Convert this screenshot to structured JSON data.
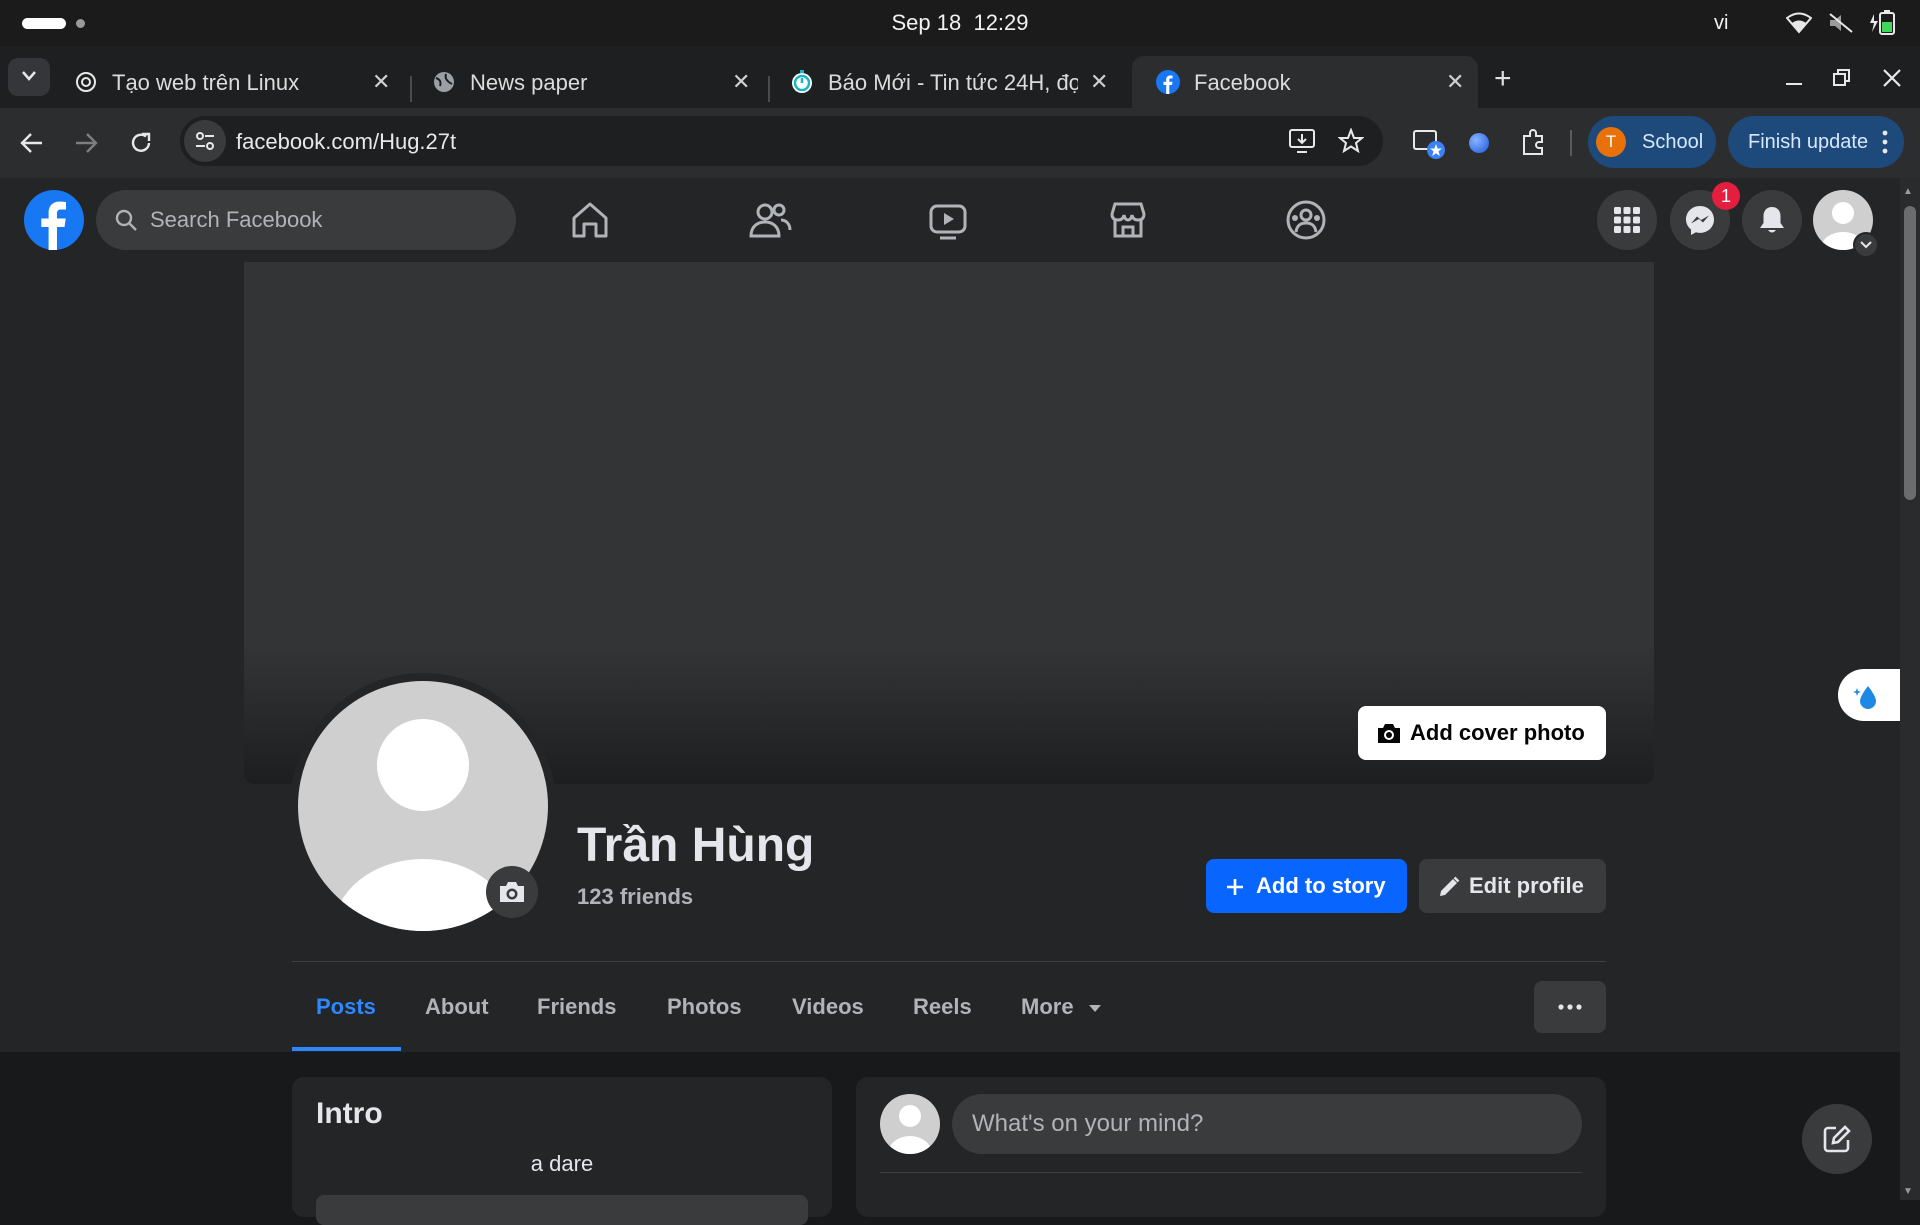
{
  "os": {
    "date": "Sep 18",
    "time": "12:29",
    "lang": "vi"
  },
  "tabs": [
    {
      "title": "Tạo web trên Linux",
      "icon": "openai-icon"
    },
    {
      "title": "News paper",
      "icon": "globe-icon"
    },
    {
      "title": "Báo Mới - Tin tức 24H, đọ",
      "icon": "stopwatch-icon"
    },
    {
      "title": "Facebook",
      "icon": "facebook-icon",
      "active": true
    }
  ],
  "browser": {
    "url": "facebook.com/Hug.27t",
    "profile_initial": "T",
    "profile_name": "School",
    "update_label": "Finish update"
  },
  "fb": {
    "search_placeholder": "Search Facebook",
    "messenger_badge": "1",
    "nav": [
      "home-icon",
      "friends-icon",
      "watch-icon",
      "marketplace-icon",
      "groups-icon"
    ]
  },
  "profile": {
    "add_cover": "Add cover photo",
    "name": "Trần Hùng",
    "friends": "123 friends",
    "add_story": "Add to story",
    "edit_profile": "Edit profile",
    "tabs": [
      "Posts",
      "About",
      "Friends",
      "Photos",
      "Videos",
      "Reels",
      "More"
    ],
    "active_tab": "Posts"
  },
  "intro": {
    "title": "Intro",
    "bio": "a dare"
  },
  "composer": {
    "placeholder": "What's on your mind?"
  },
  "colors": {
    "brand": "#1877f2",
    "primary_button": "#0866ff",
    "active_tab": "#2d88ff",
    "badge": "#e41e3f",
    "update_pill": "#1d4a7a",
    "profile_avatar": "#e8710a"
  }
}
